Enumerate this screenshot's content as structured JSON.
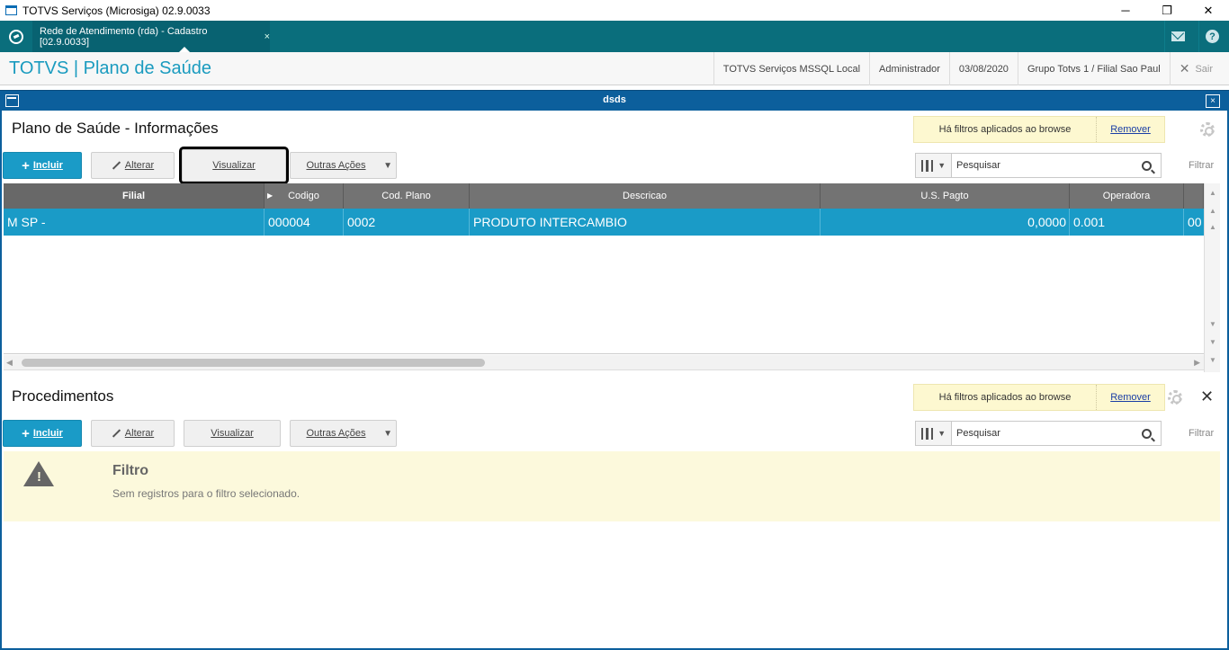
{
  "window": {
    "title": "TOTVS Serviços (Microsiga) 02.9.0033",
    "minimize": "─",
    "restore": "❐",
    "close": "✕"
  },
  "tabbar": {
    "tab_label": "Rede de Atendimento (rda) - Cadastro [02.9.0033]",
    "tab_close": "×",
    "help": "?"
  },
  "header": {
    "brand": "TOTVS | Plano de Saúde",
    "environment": "TOTVS Serviços MSSQL Local",
    "user": "Administrador",
    "date": "03/08/2020",
    "branch": "Grupo Totvs 1 / Filial Sao Paul",
    "exit_label": "Sair"
  },
  "dialog": {
    "title": "dsds",
    "close": "×"
  },
  "top_section": {
    "title": "Plano de Saúde - Informações",
    "filter_note": "Há filtros aplicados ao browse",
    "remove_link": "Remover",
    "buttons": {
      "add": "Incluir",
      "edit": "Alterar",
      "view": "Visualizar",
      "more": "Outras Ações"
    },
    "search_placeholder": "Pesquisar",
    "filter_label": "Filtrar",
    "columns": [
      "Filial",
      "Codigo",
      "Cod. Plano",
      "Descricao",
      "U.S. Pagto",
      "Operadora"
    ],
    "rows": [
      {
        "filial": "M SP    -",
        "codigo": "000004",
        "cod_plano": "0002",
        "descricao": "PRODUTO INTERCAMBIO",
        "us_pagto": "0,0000",
        "operadora": "0.001",
        "extra": "00"
      }
    ]
  },
  "bottom_section": {
    "title": "Procedimentos",
    "filter_note": "Há filtros aplicados ao browse",
    "remove_link": "Remover",
    "buttons": {
      "add": "Incluir",
      "edit": "Alterar",
      "view": "Visualizar",
      "more": "Outras Ações"
    },
    "search_placeholder": "Pesquisar",
    "filter_label": "Filtrar",
    "empty_title": "Filtro",
    "empty_message": "Sem registros para o filtro selecionado."
  },
  "colors": {
    "teal_bar": "#0a6e7c",
    "dialog_bar": "#0c5f9c",
    "primary": "#1a9bc7",
    "brand": "#1a9bbf",
    "grid_header": "#737373"
  }
}
